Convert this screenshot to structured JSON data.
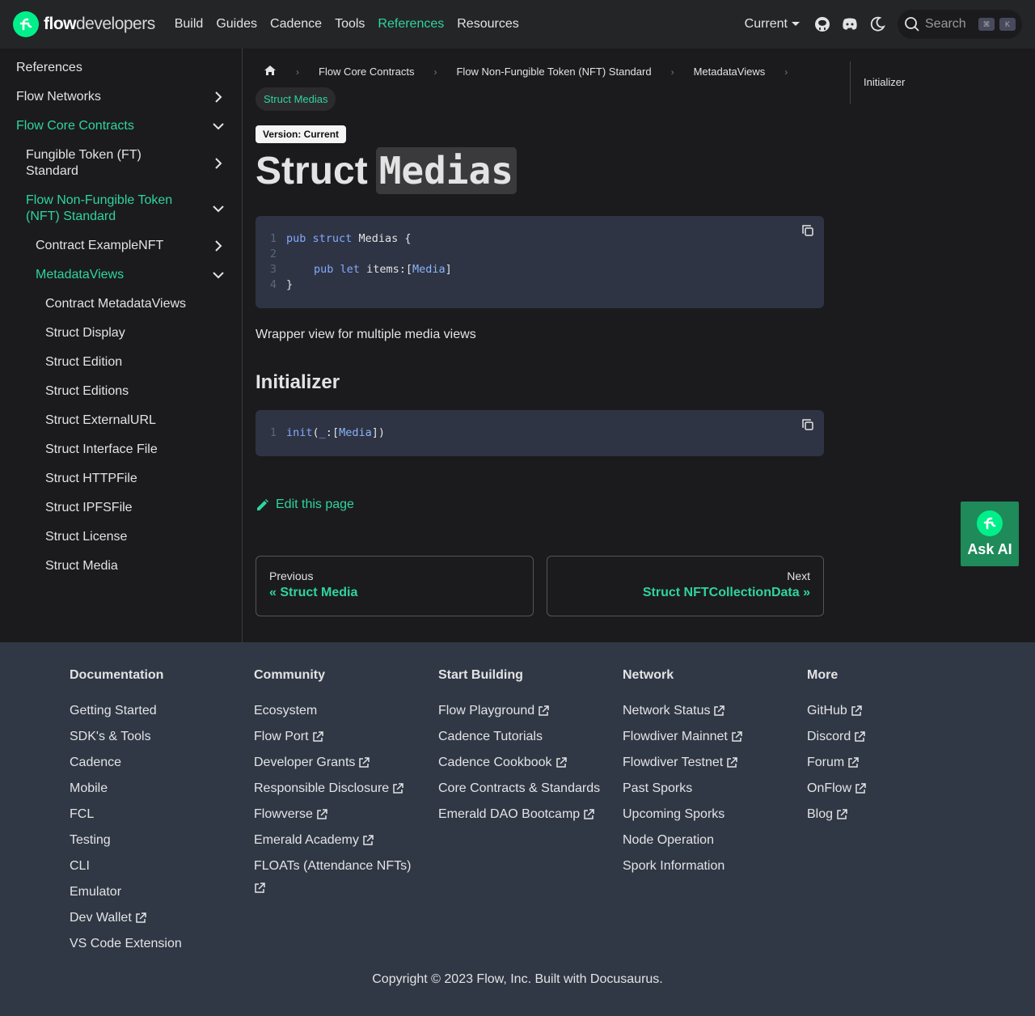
{
  "brand": {
    "bold": "flow",
    "light": "developers"
  },
  "nav": {
    "links": [
      "Build",
      "Guides",
      "Cadence",
      "Tools",
      "References",
      "Resources"
    ],
    "version": "Current",
    "search_placeholder": "Search",
    "kbd1": "⌘",
    "kbd2": "K"
  },
  "sidebar": {
    "items": [
      {
        "label": "References",
        "active": false,
        "chevron": "none"
      },
      {
        "label": "Flow Networks",
        "active": false,
        "chevron": "right"
      },
      {
        "label": "Flow Core Contracts",
        "active": true,
        "chevron": "down"
      },
      {
        "label": "Fungible Token (FT) Standard",
        "active": false,
        "chevron": "right"
      },
      {
        "label": "Flow Non-Fungible Token (NFT) Standard",
        "active": true,
        "chevron": "down"
      },
      {
        "label": "Contract ExampleNFT",
        "active": false,
        "chevron": "right"
      },
      {
        "label": "MetadataViews",
        "active": true,
        "chevron": "down"
      },
      {
        "label": "Contract MetadataViews",
        "active": false,
        "chevron": "none"
      },
      {
        "label": "Struct Display",
        "active": false,
        "chevron": "none"
      },
      {
        "label": "Struct Edition",
        "active": false,
        "chevron": "none"
      },
      {
        "label": "Struct Editions",
        "active": false,
        "chevron": "none"
      },
      {
        "label": "Struct ExternalURL",
        "active": false,
        "chevron": "none"
      },
      {
        "label": "Struct Interface File",
        "active": false,
        "chevron": "none"
      },
      {
        "label": "Struct HTTPFile",
        "active": false,
        "chevron": "none"
      },
      {
        "label": "Struct IPFSFile",
        "active": false,
        "chevron": "none"
      },
      {
        "label": "Struct License",
        "active": false,
        "chevron": "none"
      },
      {
        "label": "Struct Media",
        "active": false,
        "chevron": "none"
      }
    ]
  },
  "breadcrumb": {
    "items": [
      "Flow Core Contracts",
      "Flow Non-Fungible Token (NFT) Standard",
      "MetadataViews"
    ],
    "current": "Struct Medias"
  },
  "page": {
    "version_badge": "Version: Current",
    "title_word": "Struct",
    "title_code": "Medias",
    "code1": {
      "line1": {
        "n": "1",
        "kw1": "pub",
        "kw2": "struct",
        "name": "Medias {"
      },
      "line2": {
        "n": "2"
      },
      "line3": {
        "n": "3",
        "kw1": "pub",
        "kw2": "let",
        "name": "items: ",
        "open": "[",
        "type": "Media",
        "close": "]"
      },
      "line4": {
        "n": "4",
        "text": "}"
      }
    },
    "description": "Wrapper view for multiple media views",
    "section_title": "Initializer",
    "code2": {
      "n": "1",
      "fn": "init",
      "open": "(",
      "arg": "_",
      "colon": ": ",
      "lb": "[",
      "type": "Media",
      "rb": "])"
    },
    "edit_label": "Edit this page",
    "prev": {
      "sub": "Previous",
      "label": "« Struct Media"
    },
    "next": {
      "sub": "Next",
      "label": "Struct NFTCollectionData »"
    }
  },
  "toc": {
    "items": [
      "Initializer"
    ]
  },
  "ask_ai": "Ask AI",
  "footer": {
    "columns": [
      {
        "title": "Documentation",
        "links": [
          {
            "label": "Getting Started",
            "ext": false
          },
          {
            "label": "SDK's & Tools",
            "ext": false
          },
          {
            "label": "Cadence",
            "ext": false
          },
          {
            "label": "Mobile",
            "ext": false
          },
          {
            "label": "FCL",
            "ext": false
          },
          {
            "label": "Testing",
            "ext": false
          },
          {
            "label": "CLI",
            "ext": false
          },
          {
            "label": "Emulator",
            "ext": false
          },
          {
            "label": "Dev Wallet",
            "ext": true
          },
          {
            "label": "VS Code Extension",
            "ext": false
          }
        ]
      },
      {
        "title": "Community",
        "links": [
          {
            "label": "Ecosystem",
            "ext": false
          },
          {
            "label": "Flow Port",
            "ext": true
          },
          {
            "label": "Developer Grants",
            "ext": true
          },
          {
            "label": "Responsible Disclosure",
            "ext": true
          },
          {
            "label": "Flowverse",
            "ext": true
          },
          {
            "label": "Emerald Academy",
            "ext": true
          },
          {
            "label": "FLOATs (Attendance NFTs)",
            "ext": true
          }
        ]
      },
      {
        "title": "Start Building",
        "links": [
          {
            "label": "Flow Playground",
            "ext": true
          },
          {
            "label": "Cadence Tutorials",
            "ext": false
          },
          {
            "label": "Cadence Cookbook",
            "ext": true
          },
          {
            "label": "Core Contracts & Standards",
            "ext": false
          },
          {
            "label": "Emerald DAO Bootcamp",
            "ext": true
          }
        ]
      },
      {
        "title": "Network",
        "links": [
          {
            "label": "Network Status",
            "ext": true
          },
          {
            "label": "Flowdiver Mainnet",
            "ext": true
          },
          {
            "label": "Flowdiver Testnet",
            "ext": true
          },
          {
            "label": "Past Sporks",
            "ext": false
          },
          {
            "label": "Upcoming Sporks",
            "ext": false
          },
          {
            "label": "Node Operation",
            "ext": false
          },
          {
            "label": "Spork Information",
            "ext": false
          }
        ]
      },
      {
        "title": "More",
        "links": [
          {
            "label": "GitHub",
            "ext": true
          },
          {
            "label": "Discord",
            "ext": true
          },
          {
            "label": "Forum",
            "ext": true
          },
          {
            "label": "OnFlow",
            "ext": true
          },
          {
            "label": "Blog",
            "ext": true
          }
        ]
      }
    ],
    "copyright": "Copyright © 2023 Flow, Inc. Built with Docusaurus."
  },
  "colors": {
    "accent": "#2fd49f",
    "navbar": "#242526",
    "bg": "#1b1b1d",
    "footer": "#303846",
    "code_bg": "#2f3444"
  }
}
